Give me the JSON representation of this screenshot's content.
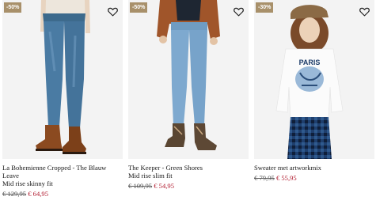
{
  "colors": {
    "badge": "#a8906a",
    "sale_price": "#b01a2e",
    "background": "#f4f4f4"
  },
  "products": [
    {
      "badge": "-50%",
      "favorite_icon": "heart-outline-icon",
      "name": "La Bohemienne Cropped - The Blauw Leave",
      "fit": "Mid rise skinny fit",
      "old_price": "€ 129,95",
      "new_price": "€ 64,95"
    },
    {
      "badge": "-50%",
      "favorite_icon": "heart-outline-icon",
      "name": "The Keeper - Green Shores",
      "fit": "Mid rise slim fit",
      "old_price": "€ 109,95",
      "new_price": "€ 54,95"
    },
    {
      "badge": "-30%",
      "favorite_icon": "heart-outline-icon",
      "name": "Sweater met artworkmix",
      "fit": "",
      "old_price": "€ 79,95",
      "new_price": "€ 55,95",
      "print_text": "PARIS"
    }
  ]
}
